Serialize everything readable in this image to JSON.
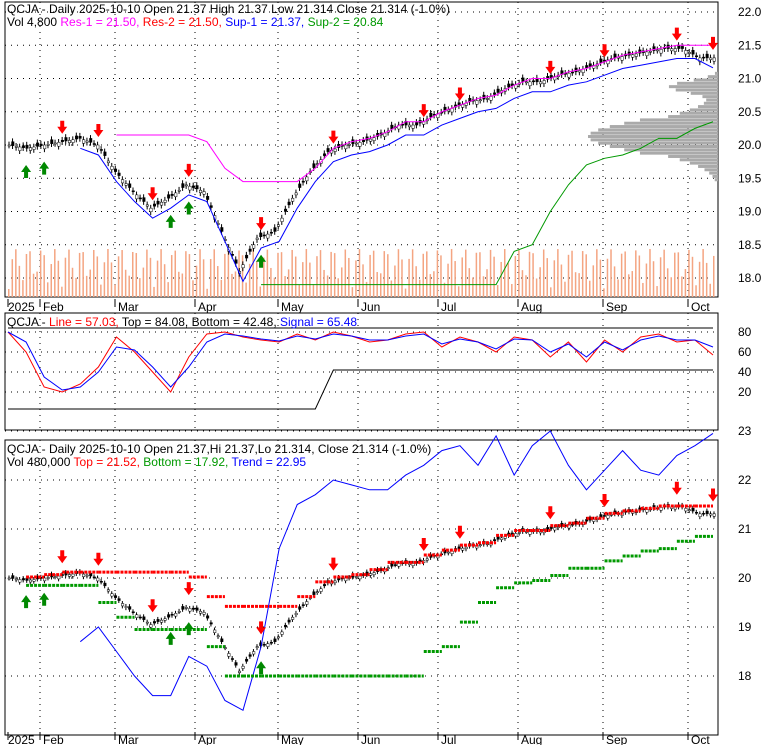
{
  "header1": {
    "symbol": "QCJA",
    "line1": "QCJA - Daily 2025-10-10 Open 21.37  High 21.37  Low 21.314  Close 21.314 (-1.0%)",
    "vol": "Vol 4,800",
    "res1": "Res-1 = 21.50,",
    "res2": "Res-2 = 21.50,",
    "sup1": "Sup-1 = 21.37,",
    "sup2": "Sup-2 = 20.84"
  },
  "header2": {
    "sym": "QCJA -",
    "line": "Line = 57.03,",
    "top": "Top = 84.08,",
    "bottom": "Bottom = 42.48,",
    "signal": "Signal = 65.48"
  },
  "header3": {
    "line1": "QCJA - Daily 2025-10-10 Open 21.37,Hi 21.37,Lo 21.314, Close 21.314 (-1.0%)",
    "vol": "Vol 480,000",
    "top": "Top = 21.52,",
    "bottom": "Bottom = 17.92,",
    "trend": "Trend = 22.95"
  },
  "colors": {
    "res1": "#ff00ff",
    "res2": "#ff0000",
    "sup1": "#0000ff",
    "sup2": "#009900",
    "volume": "#f4a582",
    "up_arrow": "#008800",
    "down_arrow": "#ff0000"
  },
  "chart_data": {
    "type": "candlestick",
    "months": [
      "2025",
      "Feb",
      "Mar",
      "Apr",
      "May",
      "Jun",
      "Jul",
      "Aug",
      "Sep",
      "Oct"
    ],
    "price_axis": [
      "22.0",
      "21.5",
      "21.0",
      "20.5",
      "20.0",
      "19.5",
      "19.0",
      "18.5",
      "18.0"
    ],
    "osc_axis": [
      "80",
      "60",
      "40",
      "20"
    ],
    "lower_axis": [
      "23",
      "22",
      "21",
      "20",
      "19",
      "18"
    ],
    "weekly_close": [
      20.0,
      19.95,
      20.0,
      20.05,
      20.1,
      20.0,
      19.6,
      19.3,
      19.05,
      19.2,
      19.4,
      19.3,
      18.7,
      18.1,
      18.6,
      18.7,
      19.2,
      19.6,
      19.9,
      20.0,
      20.05,
      20.15,
      20.3,
      20.3,
      20.45,
      20.55,
      20.65,
      20.7,
      20.85,
      20.95,
      20.95,
      21.05,
      21.1,
      21.2,
      21.3,
      21.35,
      21.4,
      21.45,
      21.45,
      21.31
    ],
    "oscillator_line": [
      80,
      60,
      25,
      20,
      28,
      45,
      75,
      60,
      40,
      20,
      55,
      78,
      80,
      75,
      72,
      70,
      78,
      72,
      80,
      76,
      70,
      72,
      78,
      80,
      65,
      75,
      70,
      60,
      75,
      72,
      55,
      70,
      50,
      72,
      60,
      75,
      78,
      70,
      72,
      57
    ],
    "signal_line": [
      80,
      70,
      35,
      22,
      25,
      40,
      65,
      62,
      45,
      25,
      45,
      70,
      78,
      76,
      73,
      71,
      76,
      73,
      78,
      76,
      72,
      72,
      76,
      78,
      68,
      73,
      70,
      63,
      73,
      72,
      60,
      68,
      55,
      70,
      62,
      72,
      76,
      72,
      72,
      65
    ],
    "trend_line": [
      null,
      null,
      null,
      null,
      18.7,
      19.0,
      18.5,
      18.0,
      17.6,
      17.6,
      18.4,
      18.2,
      17.5,
      17.3,
      18.6,
      20.6,
      21.5,
      21.7,
      22.0,
      21.9,
      21.8,
      21.8,
      22.1,
      22.3,
      22.6,
      22.7,
      22.3,
      22.9,
      22.1,
      22.7,
      23.0,
      22.3,
      21.8,
      22.2,
      22.6,
      22.2,
      22.1,
      22.5,
      22.7,
      22.95
    ]
  }
}
